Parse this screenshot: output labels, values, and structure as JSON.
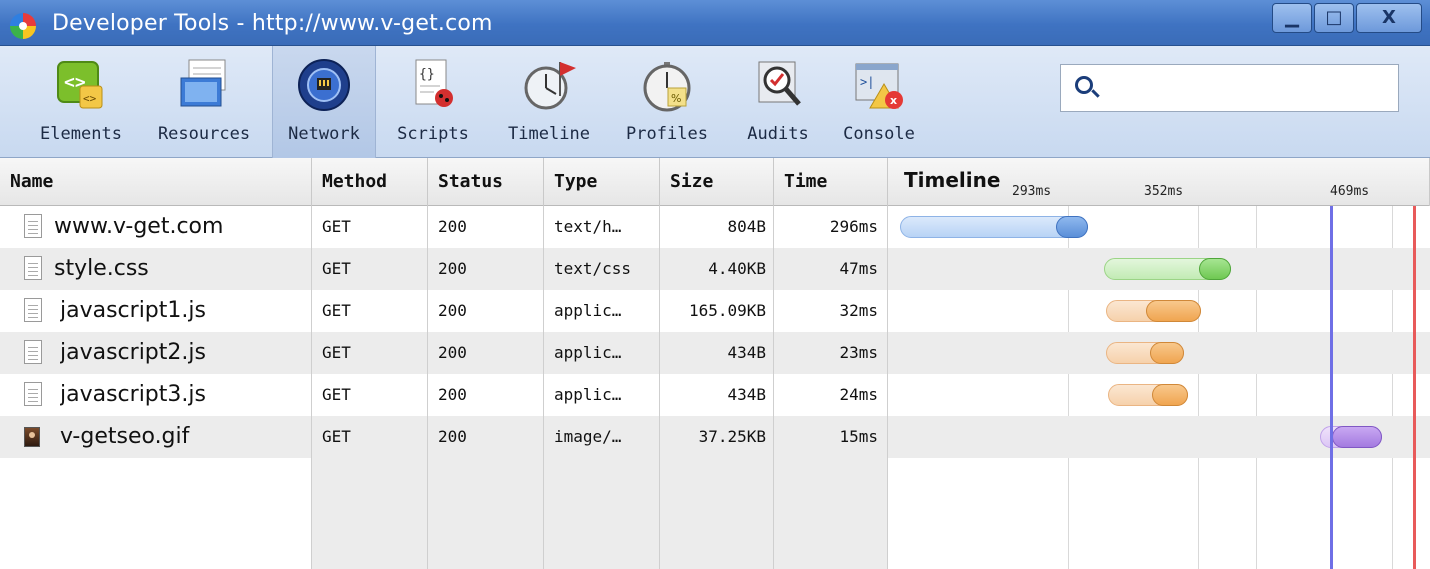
{
  "window": {
    "title": "Developer Tools - http://www.v-get.com",
    "buttons": {
      "minimize": "▁",
      "maximize": "□",
      "close": "X"
    }
  },
  "toolbar": {
    "tools": [
      {
        "label": "Elements",
        "icon": "elements-icon"
      },
      {
        "label": "Resources",
        "icon": "resources-icon"
      },
      {
        "label": "Network",
        "icon": "network-icon",
        "selected": true
      },
      {
        "label": "Scripts",
        "icon": "scripts-icon"
      },
      {
        "label": "Timeline",
        "icon": "timeline-icon"
      },
      {
        "label": "Profiles",
        "icon": "profiles-icon"
      },
      {
        "label": "Audits",
        "icon": "audits-icon"
      },
      {
        "label": "Console",
        "icon": "console-icon"
      }
    ],
    "search": {
      "placeholder": "",
      "value": ""
    }
  },
  "grid": {
    "columns": [
      "Name",
      "Method",
      "Status",
      "Type",
      "Size",
      "Time",
      "Timeline"
    ],
    "timeline_ticks": [
      "293ms",
      "352ms",
      "469ms"
    ],
    "rows": [
      {
        "name": "www.v-get.com",
        "method": "GET",
        "status": "200",
        "type": "text/h…",
        "size": "804B",
        "time": "296ms",
        "icon": "document-icon"
      },
      {
        "name": "style.css",
        "method": "GET",
        "status": "200",
        "type": "text/css",
        "size": "4.40KB",
        "time": "47ms",
        "icon": "document-icon"
      },
      {
        "name": "javascript1.js",
        "method": "GET",
        "status": "200",
        "type": "applic…",
        "size": "165.09KB",
        "time": "32ms",
        "icon": "document-icon"
      },
      {
        "name": "javascript2.js",
        "method": "GET",
        "status": "200",
        "type": "applic…",
        "size": "434B",
        "time": "23ms",
        "icon": "document-icon"
      },
      {
        "name": "javascript3.js",
        "method": "GET",
        "status": "200",
        "type": "applic…",
        "size": "434B",
        "time": "24ms",
        "icon": "document-icon"
      },
      {
        "name": "v-getseo.gif",
        "method": "GET",
        "status": "200",
        "type": "image/…",
        "size": "37.25KB",
        "time": "15ms",
        "icon": "image-icon"
      }
    ]
  },
  "colors": {
    "document": "#6fa3e6",
    "stylesheet": "#7dd06a",
    "script": "#f2b066",
    "image": "#b28ae6",
    "dom_content_marker": "#6f6fe6",
    "load_marker": "#e85a5a"
  }
}
